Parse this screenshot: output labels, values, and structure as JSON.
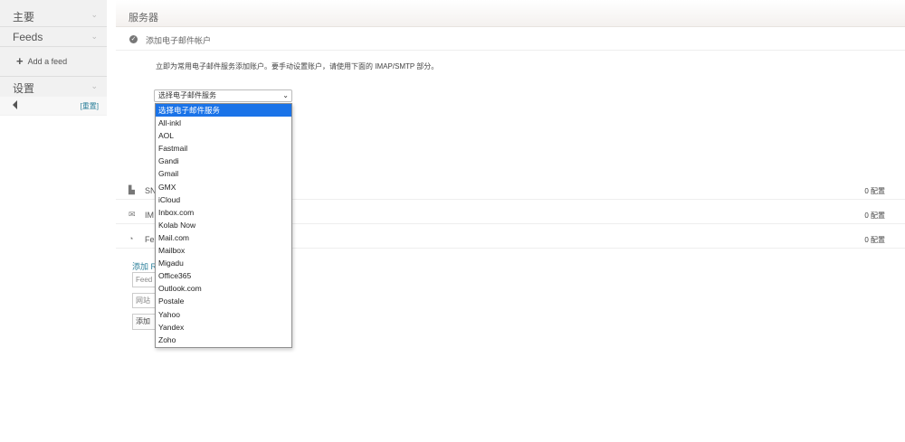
{
  "sidebar": {
    "main_label": "主要",
    "feeds_label": "Feeds",
    "add_feed_label": "Add a feed",
    "settings_label": "设置",
    "reset_label": "[重置]"
  },
  "main": {
    "header_title": "服务器",
    "account_label": "添加电子邮件帐户",
    "description": "立即为常用电子邮件服务添加账户。要手动设置账户，请使用下面的 IMAP/SMTP 部分。",
    "select_value": "选择电子邮件服务",
    "rows": [
      {
        "name": "SMTP",
        "visible_name": "SN",
        "count": "0 配置"
      },
      {
        "name": "IMAP",
        "visible_name": "IM",
        "count": "0 配置"
      },
      {
        "name": "Feeds",
        "visible_name": "Fe",
        "count": "0 配置"
      }
    ],
    "feed_add_label": "添加 R",
    "feed_input_placeholder": "Feed",
    "website_input_placeholder": "网站",
    "add_button_label": "添加"
  },
  "dropdown": {
    "options": [
      "选择电子邮件服务",
      "All-inkl",
      "AOL",
      "Fastmail",
      "Gandi",
      "Gmail",
      "GMX",
      "iCloud",
      "Inbox.com",
      "Kolab Now",
      "Mail.com",
      "Mailbox",
      "Migadu",
      "Office365",
      "Outlook.com",
      "Postale",
      "Yahoo",
      "Yandex",
      "Zoho"
    ],
    "selected_index": 0
  },
  "colors": {
    "accent": "#1a73e8",
    "link": "#2a7f9a",
    "sidebar_bg": "#f1f1f1"
  }
}
